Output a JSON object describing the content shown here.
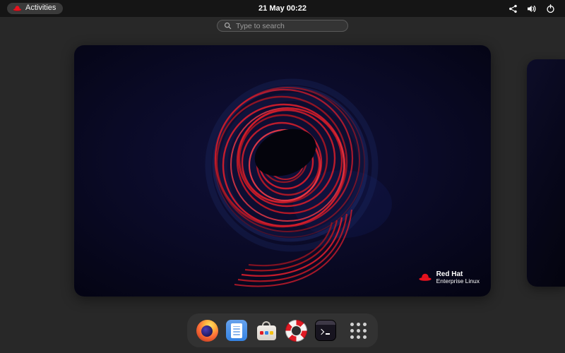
{
  "top_bar": {
    "activities_label": "Activities",
    "clock": "21 May 00:22",
    "status_icons": [
      "network-icon",
      "volume-icon",
      "power-icon"
    ]
  },
  "search": {
    "placeholder": "Type to search",
    "icon": "search-icon"
  },
  "workspace": {
    "brand": {
      "logo_icon": "red-hat-fedora-icon",
      "line1": "Red Hat",
      "line2": "Enterprise Linux"
    }
  },
  "dash": {
    "apps": [
      {
        "icon": "firefox-icon"
      },
      {
        "icon": "text-editor-icon"
      },
      {
        "icon": "software-icon"
      },
      {
        "icon": "help-icon"
      },
      {
        "icon": "terminal-icon"
      }
    ],
    "show_apps_icon": "app-grid-icon"
  },
  "colors": {
    "redhat_red": "#e8121e",
    "accent_blue": "#3584e4",
    "wallpaper_base": "#0a0a26",
    "shell_background": "#282828",
    "top_bar_background": "#151515"
  }
}
